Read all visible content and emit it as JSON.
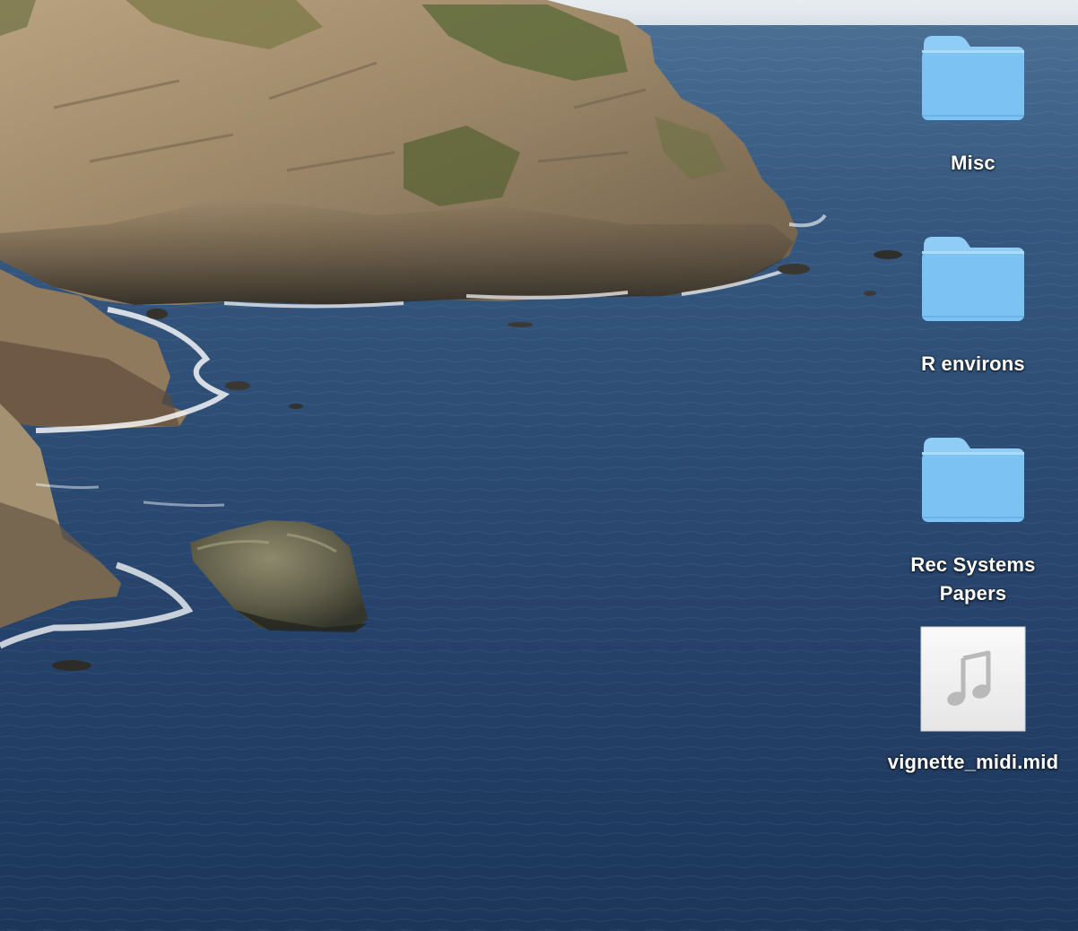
{
  "desktop": {
    "wallpaper": "coastal cliffs over the ocean",
    "icons": [
      {
        "label": "Misc",
        "kind": "folder",
        "icon": "folder-icon"
      },
      {
        "label": "R environs",
        "kind": "folder",
        "icon": "folder-icon"
      },
      {
        "label": "Rec Systems\nPapers",
        "kind": "folder",
        "icon": "folder-icon"
      },
      {
        "label": "vignette_midi.mid",
        "kind": "file",
        "icon": "music-note-icon"
      }
    ]
  },
  "colors": {
    "folder_light": "#9dd6fb",
    "folder_main": "#7bc3f4",
    "ocean": "#2a4b73",
    "label_text": "#ffffff"
  }
}
